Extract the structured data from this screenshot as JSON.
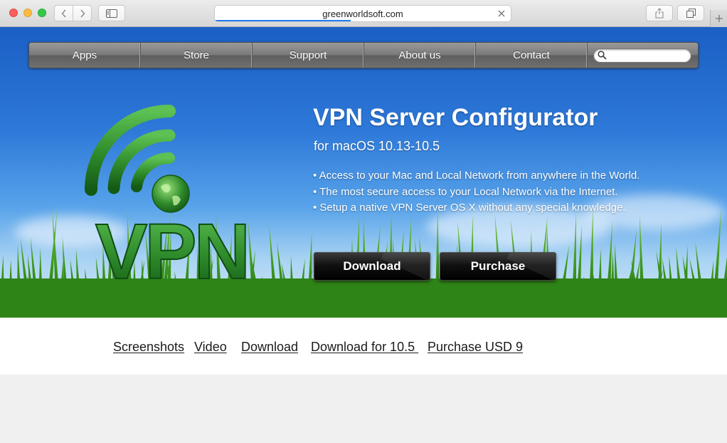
{
  "browser": {
    "url": "greenworldsoft.com",
    "load_progress": 0.46
  },
  "topnav": {
    "items": [
      "Apps",
      "Store",
      "Support",
      "About us",
      "Contact"
    ],
    "search_placeholder": ""
  },
  "hero": {
    "logo_text": "VPN",
    "title": "VPN Server Configurator",
    "subtitle": "for macOS 10.13-10.5",
    "features": [
      "• Access to your Mac and Local Network from anywhere in the World.",
      "• The most secure access to your Local Network via the Internet.",
      "• Setup a native VPN Server OS X without any special knowledge."
    ],
    "download_label": "Download",
    "purchase_label": "Purchase"
  },
  "sublinks": [
    "Screenshots",
    "Video",
    "Download",
    "Download for 10.5 ",
    "Purchase USD 9"
  ],
  "colors": {
    "sky_top": "#1b5fc4",
    "grass": "#3f9a1e",
    "logo_green": "#2e8a2a",
    "button_black": "#000000"
  }
}
